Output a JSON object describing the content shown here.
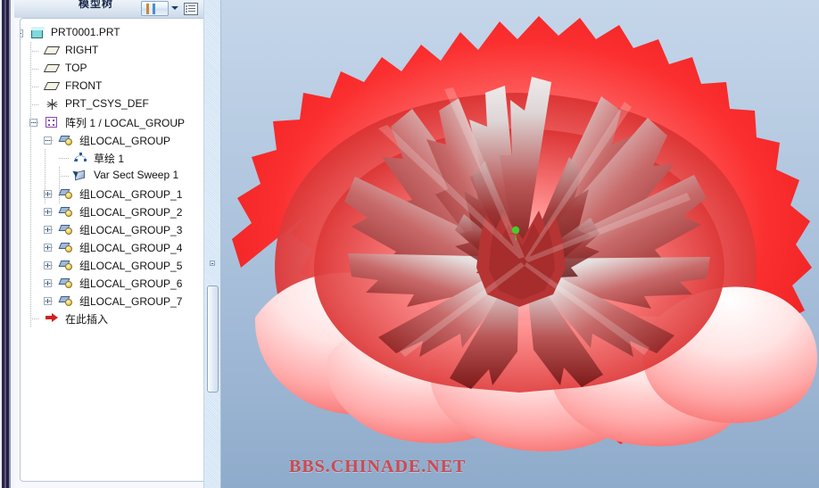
{
  "window": {
    "panel_title": "模型树"
  },
  "toolbar": {
    "display_button_label": "",
    "display_button_icon": "column-display-icon",
    "settings_button_label": "",
    "settings_button_icon": "list-settings-icon",
    "dropdown_icon": "chevron-down-icon"
  },
  "tree": {
    "items": [
      {
        "label": "PRT0001.PRT",
        "icon": "part-icon",
        "depth": 0,
        "expander": "minus"
      },
      {
        "label": "RIGHT",
        "icon": "datum-plane-icon",
        "depth": 1,
        "expander": "none"
      },
      {
        "label": "TOP",
        "icon": "datum-plane-icon",
        "depth": 1,
        "expander": "none"
      },
      {
        "label": "FRONT",
        "icon": "datum-plane-icon",
        "depth": 1,
        "expander": "none"
      },
      {
        "label": "PRT_CSYS_DEF",
        "icon": "coordinate-system-icon",
        "depth": 1,
        "expander": "none"
      },
      {
        "label": "阵列 1 / LOCAL_GROUP",
        "icon": "pattern-icon",
        "depth": 1,
        "expander": "minus"
      },
      {
        "label": "组LOCAL_GROUP",
        "icon": "group-icon",
        "depth": 2,
        "expander": "minus"
      },
      {
        "label": "草绘 1",
        "icon": "sketch-icon",
        "depth": 3,
        "expander": "none"
      },
      {
        "label": "Var Sect Sweep 1",
        "icon": "sweep-icon",
        "depth": 3,
        "expander": "none"
      },
      {
        "label": "组LOCAL_GROUP_1",
        "icon": "group-icon",
        "depth": 2,
        "expander": "plus"
      },
      {
        "label": "组LOCAL_GROUP_2",
        "icon": "group-icon",
        "depth": 2,
        "expander": "plus"
      },
      {
        "label": "组LOCAL_GROUP_3",
        "icon": "group-icon",
        "depth": 2,
        "expander": "plus"
      },
      {
        "label": "组LOCAL_GROUP_4",
        "icon": "group-icon",
        "depth": 2,
        "expander": "plus"
      },
      {
        "label": "组LOCAL_GROUP_5",
        "icon": "group-icon",
        "depth": 2,
        "expander": "plus"
      },
      {
        "label": "组LOCAL_GROUP_6",
        "icon": "group-icon",
        "depth": 2,
        "expander": "plus"
      },
      {
        "label": "组LOCAL_GROUP_7",
        "icon": "group-icon",
        "depth": 2,
        "expander": "plus"
      },
      {
        "label": "在此插入",
        "icon": "insert-here-icon",
        "depth": 1,
        "expander": "none"
      }
    ]
  },
  "viewport": {
    "watermark": "BBS.CHINADE.NET",
    "model_description": "red peony flower solid model",
    "csys_marker_color": "#3fd02a",
    "background_top_color": "#c5d6ea",
    "background_bottom_color": "#8fabcb"
  },
  "colors": {
    "petal_bright_red": "#f42b2b",
    "petal_dark_red": "#8c1f1f",
    "petal_pale": "#fdf2f2",
    "watermark_red": "#d62626"
  }
}
